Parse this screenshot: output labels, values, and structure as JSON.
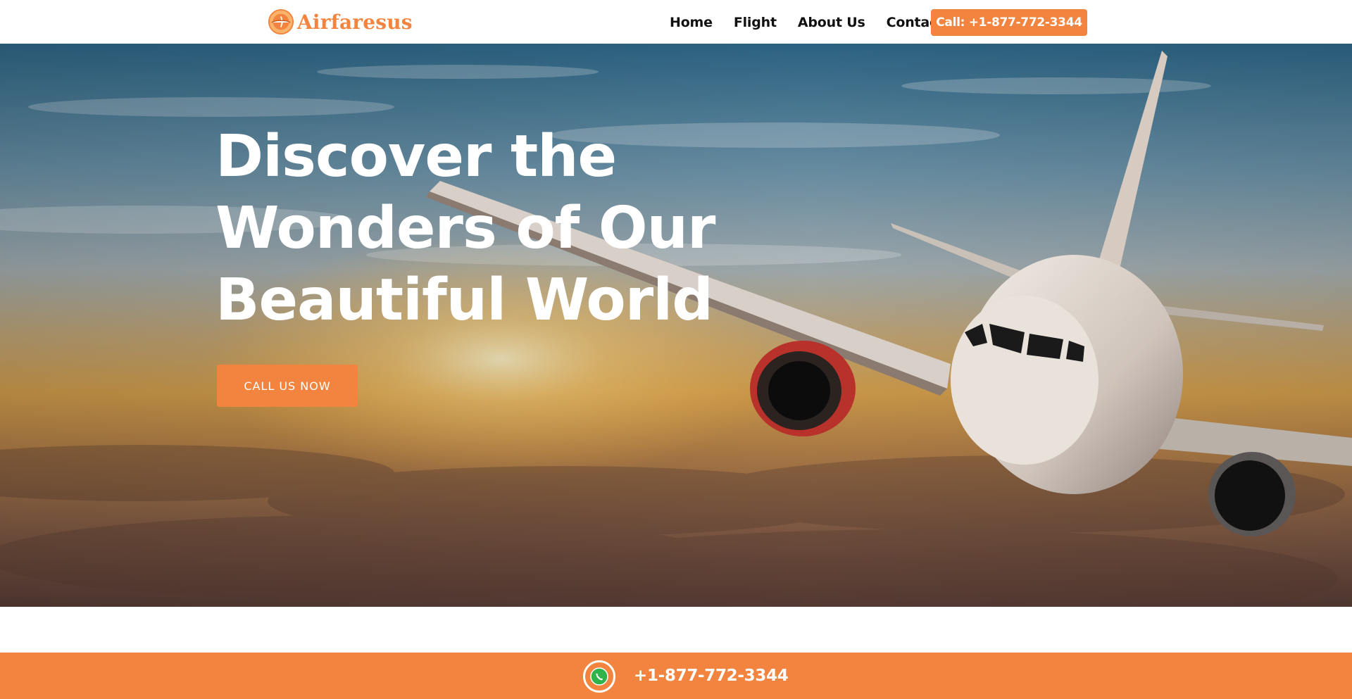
{
  "brand": {
    "name": "Airfaresus",
    "color": "#f2843f"
  },
  "header": {
    "nav": [
      {
        "label": "Home"
      },
      {
        "label": "Flight"
      },
      {
        "label": "About Us"
      },
      {
        "label": "Contact"
      }
    ],
    "call_button": "Call: +1-877-772-3344"
  },
  "hero": {
    "title_lines": [
      "Discover the",
      "Wonders of Our",
      "Beautiful World"
    ],
    "cta_label": "CALL US NOW",
    "background": "airplane-above-clouds-at-sunset"
  },
  "callbar": {
    "icon": "whatsapp-icon",
    "phone": "+1-877-772-3344"
  }
}
